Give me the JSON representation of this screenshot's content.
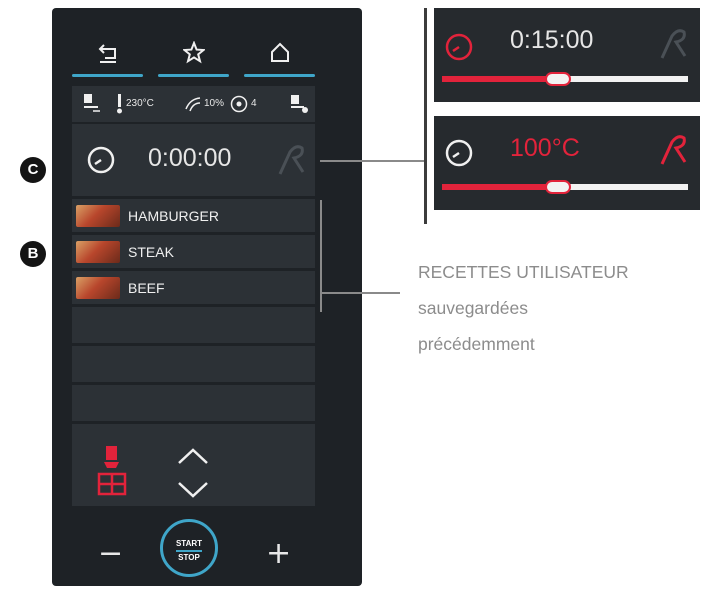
{
  "status_bar": {
    "temperature": "230°C",
    "humidity": "10%",
    "fan_level": "4"
  },
  "timer": {
    "value": "0:00:00"
  },
  "recipes": [
    {
      "name": "HAMBURGER"
    },
    {
      "name": "STEAK"
    },
    {
      "name": "BEEF"
    }
  ],
  "footer": {
    "minus_label": "−",
    "plus_label": "+",
    "start_label": "START",
    "stop_label": "STOP"
  },
  "badges": {
    "c": "C",
    "b": "B"
  },
  "callout_time": {
    "value": "0:15:00",
    "slider_fraction": 0.47
  },
  "callout_temp": {
    "value": "100°C",
    "slider_fraction": 0.47
  },
  "caption": {
    "line1": "RECETTES UTILISATEUR",
    "line2": "sauvegardées",
    "line3": "précédemment"
  },
  "colors": {
    "accent_blue": "#3fa6c9",
    "accent_red": "#e2233b",
    "panel_dark": "#1e2226"
  },
  "icons": [
    "back-icon",
    "star-icon",
    "home-icon",
    "clock-icon",
    "probe-icon",
    "recipe-book-icon",
    "chevron-up-icon",
    "chevron-down-icon"
  ]
}
